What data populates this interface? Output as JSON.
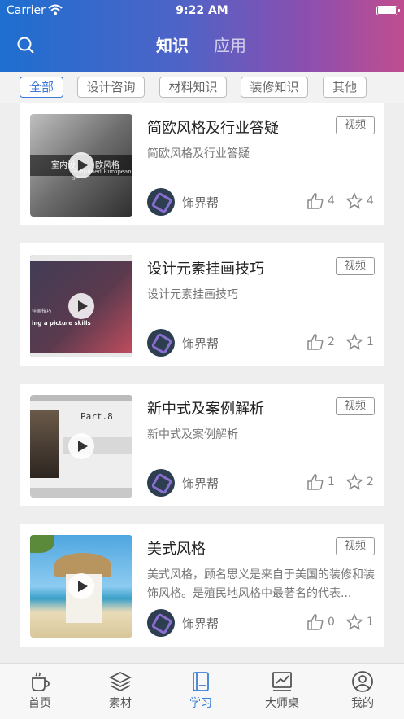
{
  "status": {
    "carrier": "Carrier",
    "time": "9:22 AM"
  },
  "header": {
    "tabs": [
      "知识",
      "应用"
    ]
  },
  "filters": [
    "全部",
    "设计咨询",
    "材料知识",
    "装修知识",
    "其他"
  ],
  "cards": [
    {
      "title": "简欧风格及行业答疑",
      "badge": "视频",
      "desc": "简欧风格及行业答疑",
      "author": "饰界帮",
      "likes": "4",
      "favs": "4"
    },
    {
      "title": "设计元素挂画技巧",
      "badge": "视频",
      "desc": "设计元素挂画技巧",
      "author": "饰界帮",
      "likes": "2",
      "favs": "1"
    },
    {
      "title": "新中式及案例解析",
      "badge": "视频",
      "desc": "新中式及案例解析",
      "author": "饰界帮",
      "likes": "1",
      "favs": "2"
    },
    {
      "title": "美式风格",
      "badge": "视频",
      "desc": "美式风格，顾名思义是来自于美国的装修和装饰风格。是殖民地风格中最著名的代表...",
      "author": "饰界帮",
      "likes": "0",
      "favs": "1"
    }
  ],
  "thumb_text": {
    "card0": [
      "室内设",
      "欧风格",
      "Simplified European s"
    ],
    "card1": [
      "挂画技巧",
      "ing a picture skills"
    ],
    "card2": [
      "Part.8"
    ]
  },
  "tabbar": [
    "首页",
    "素材",
    "学习",
    "大师桌",
    "我的"
  ],
  "colors": {
    "accent": "#3b7fd6",
    "header_start": "#1d6fd0",
    "header_end": "#c04d8f"
  }
}
